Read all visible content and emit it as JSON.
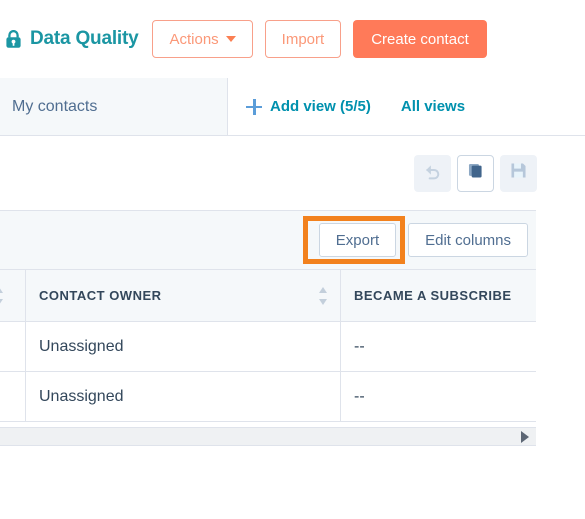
{
  "header": {
    "lock_icon": "lock-icon",
    "title": "Data Quality",
    "buttons": {
      "actions_label": "Actions",
      "import_label": "Import",
      "create_contact_label": "Create contact"
    }
  },
  "tabs": {
    "active_tab_label": "My contacts",
    "add_view_label": "Add view (5/5)",
    "add_view_icon": "plus-icon",
    "all_views_label": "All views"
  },
  "icon_toolbar": {
    "items": [
      {
        "name": "undo-icon",
        "label": "Undo",
        "state": "disabled"
      },
      {
        "name": "copy-icon",
        "label": "Clone view",
        "state": "active"
      },
      {
        "name": "save-icon",
        "label": "Save view",
        "state": "disabled"
      }
    ]
  },
  "action_bar": {
    "export_label": "Export",
    "edit_columns_label": "Edit columns",
    "highlight_target": "export-button",
    "highlight_color": "#f2811d"
  },
  "table": {
    "columns": [
      {
        "key": "col0",
        "label": "",
        "sortable": true
      },
      {
        "key": "col1",
        "label": "CONTACT OWNER",
        "sortable": true
      },
      {
        "key": "col2",
        "label": "BECAME A SUBSCRIBE",
        "sortable": false
      }
    ],
    "rows": [
      {
        "col0": "",
        "col1": "Unassigned",
        "col2": "--"
      },
      {
        "col0": "",
        "col1": "Unassigned",
        "col2": "--"
      }
    ]
  },
  "scrollbar": {
    "orientation": "horizontal",
    "arrow_icon": "caret-right-icon"
  },
  "colors": {
    "brand_orange": "#ff7a59",
    "brand_orange_light": "#fb9878",
    "teal": "#1b96a3",
    "link_blue": "#0091ae",
    "text_dark": "#33475b",
    "text_muted": "#506e91",
    "border": "#dfe3eb",
    "surface": "#f5f8fa",
    "annotation": "#f2811d"
  }
}
